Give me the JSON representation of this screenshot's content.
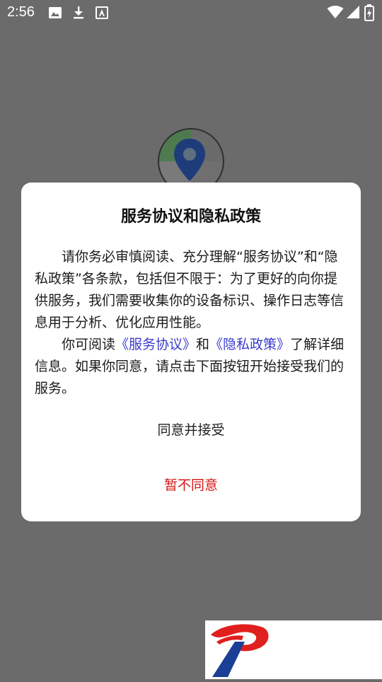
{
  "status_bar": {
    "time": "2:56",
    "icons": [
      "image-icon",
      "download-icon",
      "font-icon",
      "wifi-icon",
      "signal-icon",
      "battery-icon"
    ]
  },
  "dialog": {
    "title": "服务协议和隐私政策",
    "paragraph1": "请你务必审慎阅读、充分理解“服务协议”和“隐私政策”各条款，包括但不限于：为了更好的向你提供服务，我们需要收集你的设备标识、操作日志等信息用于分析、优化应用性能。",
    "paragraph2_prefix": "你可阅读",
    "service_link": "《服务协议》",
    "paragraph2_and": "和",
    "privacy_link": "《隐私政策》",
    "paragraph2_suffix": "了解详细信息。如果你同意，请点击下面按钮开始接受我们的服务。",
    "agree_label": "同意并接受",
    "decline_label": "暂不同意"
  },
  "colors": {
    "overlay": "#6b6b6b",
    "link": "#3a3acc",
    "decline": "#d41414",
    "logo_blue": "#1b3f95",
    "logo_red": "#e0201e"
  }
}
